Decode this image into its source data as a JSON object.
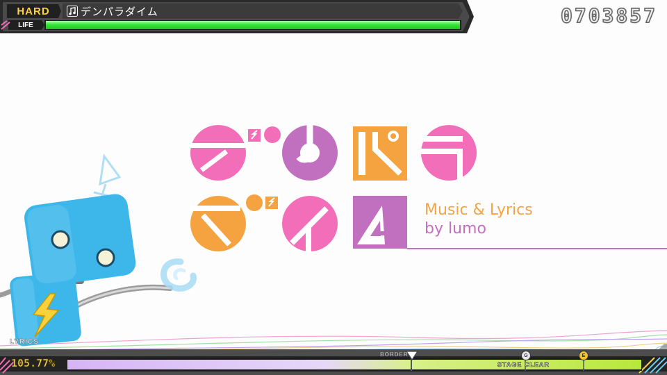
{
  "hud": {
    "difficulty": "HARD",
    "life_label": "LIFE",
    "song_title": "デンパラダイム",
    "life_fraction": 1.0,
    "score": "0703857",
    "colors": {
      "difficulty": "#ffd23c",
      "life": "#39e639",
      "hud_bg": "#3a3a3a"
    }
  },
  "title_card": {
    "credit_line_1": "Music & Lyrics",
    "credit_line_2": "by lumo",
    "colors": {
      "pink": "#f36eb9",
      "purple": "#c070bf",
      "orange": "#f5a340"
    }
  },
  "bottom_hud": {
    "lyrics_label": "LYRICS",
    "achievement_rate": "105.77%",
    "achievement_fraction": 1.0,
    "border_label": "BORDER",
    "stage_clear_label": "STAGE CLEAR",
    "rank_markers": [
      "G",
      "E"
    ]
  }
}
